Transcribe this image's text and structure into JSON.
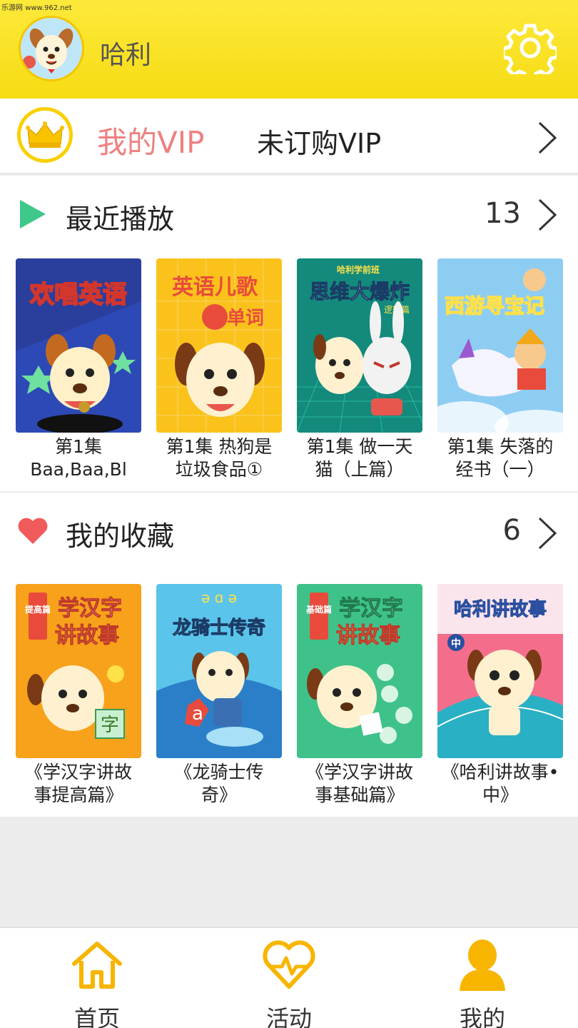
{
  "watermark": "乐游网 www.962.net",
  "header": {
    "username": "哈利",
    "settings_icon": "gear-icon"
  },
  "vip": {
    "title": "我的VIP",
    "status": "未订购VIP"
  },
  "recent": {
    "title": "最近播放",
    "count": "13",
    "items": [
      {
        "caption_line1": "第1集",
        "caption_line2": "Baa,Baa,Bl",
        "cover_text": "欢唱英语"
      },
      {
        "caption_line1": "第1集 热狗是",
        "caption_line2": "垃圾食品①",
        "cover_text": "英语儿歌",
        "cover_text2": "背单词"
      },
      {
        "caption_line1": "第1集 做一天",
        "caption_line2": "猫（上篇）",
        "cover_text": "思维大爆炸",
        "cover_small": "哈利学前班",
        "cover_tag": "逻辑篇"
      },
      {
        "caption_line1": "第1集 失落的",
        "caption_line2": "经书（一）",
        "cover_text": "西游寻宝记"
      }
    ]
  },
  "favorites": {
    "title": "我的收藏",
    "count": "6",
    "items": [
      {
        "caption_line1": "《学汉字讲故",
        "caption_line2": "事提高篇》",
        "cover_text": "学汉字",
        "cover_text2": "讲故事",
        "cover_tag": "提高篇"
      },
      {
        "caption_line1": "《龙骑士传",
        "caption_line2": "奇》",
        "cover_text": "龙骑士传奇"
      },
      {
        "caption_line1": "《学汉字讲故",
        "caption_line2": "事基础篇》",
        "cover_text": "学汉字",
        "cover_text2": "讲故事",
        "cover_tag": "基础篇"
      },
      {
        "caption_line1": "《哈利讲故事•",
        "caption_line2": "中》",
        "cover_text": "哈利讲故事",
        "cover_tag": "中"
      }
    ]
  },
  "nav": {
    "items": [
      {
        "label": "首页",
        "icon": "home-icon"
      },
      {
        "label": "活动",
        "icon": "heartbeat-icon"
      },
      {
        "label": "我的",
        "icon": "user-icon"
      }
    ]
  },
  "colors": {
    "header_yellow": "#f8e11f",
    "accent_yellow": "#f9c300",
    "vip_pink": "#ef8080",
    "play_green": "#3ec88a",
    "heart_red": "#f05a5a"
  }
}
